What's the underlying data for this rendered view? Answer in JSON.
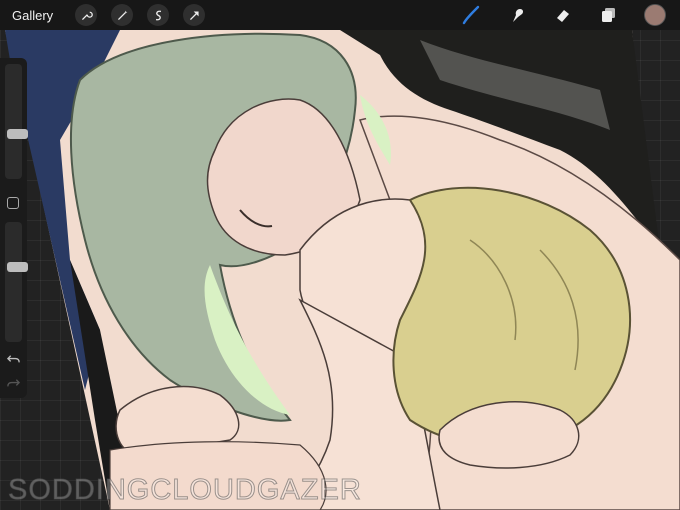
{
  "toolbar": {
    "gallery_label": "Gallery",
    "left_tools": [
      "wrench-icon",
      "magic-wand-icon",
      "selection-icon",
      "move-arrow-icon"
    ],
    "right_tools": [
      "brush-icon",
      "smudge-icon",
      "eraser-icon",
      "layers-icon"
    ],
    "active_tool": "brush-icon",
    "active_tool_color": "#2f7de0",
    "current_color": "#9b7b72"
  },
  "sidebar": {
    "brush_size_level": 0.62,
    "opacity_level": 0.36
  },
  "watermark": "SODDINGCLOUDGAZER",
  "colors": {
    "background_blue": "#2a3a63",
    "dark_hair": "#1f1f1d",
    "green_hair": "#a8b7a2",
    "blonde_hair": "#d9cf8f",
    "skin": "#f4ddd0",
    "rim_light": "#d9f1c4"
  }
}
